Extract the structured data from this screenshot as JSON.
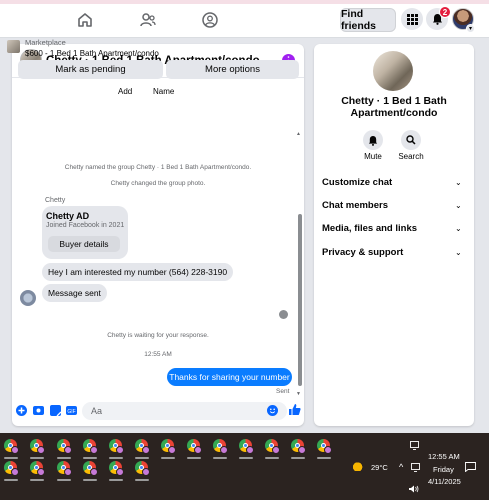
{
  "topbar": {
    "find_friends": "Find friends",
    "notification_count": "2"
  },
  "chat": {
    "title": "Chetty · 1 Bed 1 Bath Apartment/condo",
    "marketplace_label": "Marketplace",
    "marketplace_item": "$600 - 1 Bed 1 Bath Apartment/condo",
    "mark_pending": "Mark as pending",
    "more_options": "More options",
    "col_add": "Add",
    "col_name": "Name",
    "sys_named": "Chetty named the group Chetty · 1 Bed 1 Bath Apartment/condo.",
    "sys_photo": "Chetty changed the group photo.",
    "sender": "Chetty",
    "card_name": "Chetty AD",
    "card_sub": "Joined Facebook in 2021",
    "card_button": "Buyer details",
    "msg_interest": "Hey I am interested my number (564) 228-3190",
    "msg_sent": "Message sent",
    "waiting": "Chetty is waiting for your response.",
    "time": "12:55 AM",
    "msg_out": "Thanks for sharing your number",
    "sent_status": "Sent",
    "input_placeholder": "Aa"
  },
  "info": {
    "title": "Chetty · 1 Bed 1 Bath Apartment/condo",
    "mute": "Mute",
    "search": "Search",
    "rows": [
      "Customize chat",
      "Chat members",
      "Media, files and links",
      "Privacy & support"
    ]
  },
  "taskbar": {
    "temperature": "29°C",
    "time": "12:55 AM",
    "day": "Friday",
    "date": "4/11/2025"
  },
  "colors": {
    "accent": "#0a7cff",
    "badge": "#e41e3f",
    "taskbar": "#2b2320"
  }
}
